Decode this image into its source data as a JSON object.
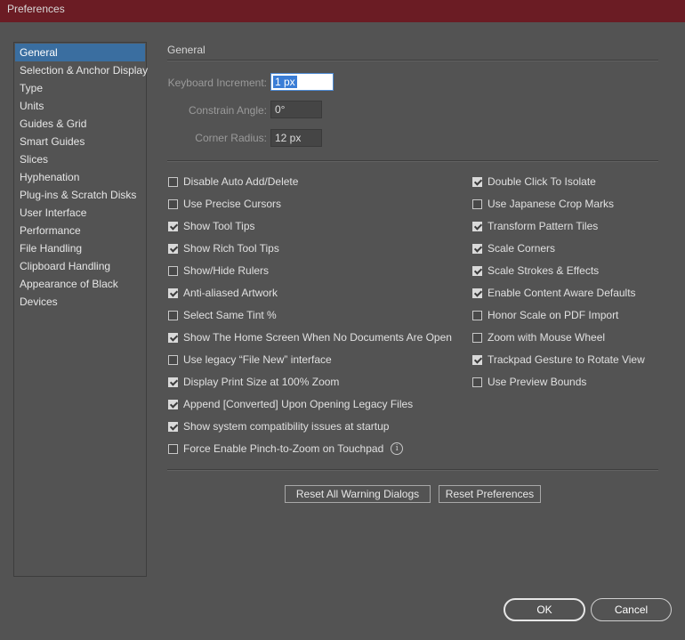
{
  "window": {
    "title": "Preferences"
  },
  "sidebar": {
    "items": [
      {
        "label": "General",
        "active": true
      },
      {
        "label": "Selection & Anchor Display"
      },
      {
        "label": "Type"
      },
      {
        "label": "Units"
      },
      {
        "label": "Guides & Grid"
      },
      {
        "label": "Smart Guides"
      },
      {
        "label": "Slices"
      },
      {
        "label": "Hyphenation"
      },
      {
        "label": "Plug-ins & Scratch Disks"
      },
      {
        "label": "User Interface"
      },
      {
        "label": "Performance"
      },
      {
        "label": "File Handling"
      },
      {
        "label": "Clipboard Handling"
      },
      {
        "label": "Appearance of Black"
      },
      {
        "label": "Devices"
      }
    ]
  },
  "general": {
    "title": "General",
    "keyboard_increment": {
      "label": "Keyboard Increment:",
      "value": "1 px"
    },
    "constrain_angle": {
      "label": "Constrain Angle:",
      "value": "0°"
    },
    "corner_radius": {
      "label": "Corner Radius:",
      "value": "12 px"
    }
  },
  "options_left": [
    {
      "label": "Disable Auto Add/Delete",
      "checked": false
    },
    {
      "label": "Use Precise Cursors",
      "checked": false
    },
    {
      "label": "Show Tool Tips",
      "checked": true
    },
    {
      "label": "Show Rich Tool Tips",
      "checked": true
    },
    {
      "label": "Show/Hide Rulers",
      "checked": false
    },
    {
      "label": "Anti-aliased Artwork",
      "checked": true
    },
    {
      "label": "Select Same Tint %",
      "checked": false
    },
    {
      "label": "Show The Home Screen When No Documents Are Open",
      "checked": true
    },
    {
      "label": "Use legacy “File New” interface",
      "checked": false
    },
    {
      "label": "Display Print Size at 100% Zoom",
      "checked": true
    },
    {
      "label": "Append [Converted] Upon Opening Legacy Files",
      "checked": true
    },
    {
      "label": "Show system compatibility issues at startup",
      "checked": true
    },
    {
      "label": "Force Enable Pinch-to-Zoom on Touchpad",
      "checked": false,
      "info": true
    }
  ],
  "options_right": [
    {
      "label": "Double Click To Isolate",
      "checked": true
    },
    {
      "label": "Use Japanese Crop Marks",
      "checked": false
    },
    {
      "label": "Transform Pattern Tiles",
      "checked": true
    },
    {
      "label": "Scale Corners",
      "checked": true
    },
    {
      "label": "Scale Strokes & Effects",
      "checked": true
    },
    {
      "label": "Enable Content Aware Defaults",
      "checked": true
    },
    {
      "label": "Honor Scale on PDF Import",
      "checked": false
    },
    {
      "label": "Zoom with Mouse Wheel",
      "checked": false
    },
    {
      "label": "Trackpad Gesture to Rotate View",
      "checked": true
    },
    {
      "label": "Use Preview Bounds",
      "checked": false
    }
  ],
  "info_glyph": "i",
  "buttons": {
    "reset_warnings": "Reset All Warning Dialogs",
    "reset_prefs": "Reset Preferences",
    "ok": "OK",
    "cancel": "Cancel"
  }
}
